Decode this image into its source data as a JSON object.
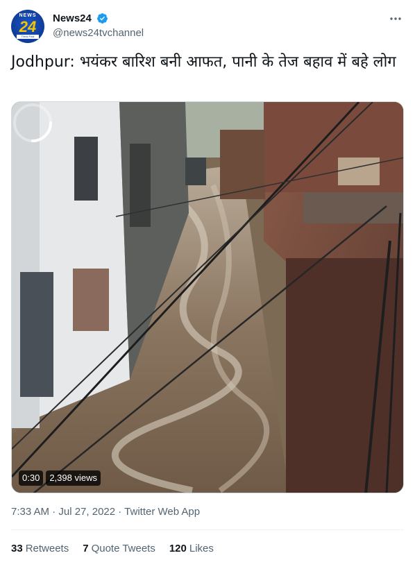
{
  "tweet": {
    "display_name": "News24",
    "handle": "@news24tvchannel",
    "avatar_text": {
      "top": "NEWS",
      "number": "24",
      "tagline": "Think First"
    },
    "text": "Jodhpur: भयंकर बारिश बनी आफत, पानी के तेज बहाव में बहे लोग",
    "timestamp": "7:33 AM · Jul 27, 2022 · Twitter Web App"
  },
  "video": {
    "duration": "0:30",
    "views": "2,398 views",
    "state": "loading"
  },
  "stats": {
    "retweets_count": "33",
    "retweets_label": "Retweets",
    "quotes_count": "7",
    "quotes_label": "Quote Tweets",
    "likes_count": "120",
    "likes_label": "Likes"
  },
  "colors": {
    "verified_blue": "#1d9bf0",
    "text_primary": "#0f1419",
    "text_secondary": "#536471"
  },
  "icons": {
    "more": "more-dots-icon",
    "verified": "verified-badge-icon",
    "loading": "loading-spinner-icon"
  }
}
